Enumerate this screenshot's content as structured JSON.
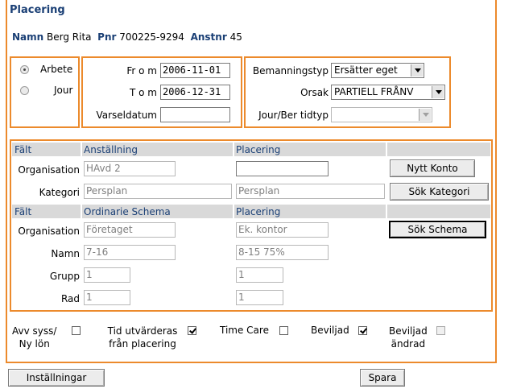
{
  "title": "Placering",
  "person": {
    "namn_label": "Namn",
    "namn_value": "Berg Rita",
    "pnr_label": "Pnr",
    "pnr_value": "700225-9294",
    "anstnr_label": "Anstnr",
    "anstnr_value": "45"
  },
  "type_radio": {
    "arbete": "Arbete",
    "jour": "Jour",
    "selected": "Arbete"
  },
  "dates": {
    "from_label": "Fr o m",
    "from_value": "2006-11-01",
    "tom_label": "T o m",
    "tom_value": "2006-12-31",
    "varsel_label": "Varseldatum",
    "varsel_value": ""
  },
  "staffing": {
    "bemanningstyp_label": "Bemanningstyp",
    "bemanningstyp_value": "Ersätter eget",
    "orsak_label": "Orsak",
    "orsak_value": "PARTIELL FRÅNV",
    "jourber_label": "Jour/Ber tidtyp",
    "jourber_value": ""
  },
  "grid": {
    "col_falt": "Fält",
    "col_anstallning": "Anställning",
    "col_placering": "Placering",
    "col_ordinarie": "Ordinarie Schema",
    "rows": {
      "organisation": "Organisation",
      "kategori": "Kategori",
      "namn": "Namn",
      "grupp": "Grupp",
      "rad": "Rad"
    },
    "anst_org": "HAvd 2",
    "plac_org": "",
    "anst_kat": "Persplan",
    "plac_kat": "Persplan",
    "ord_org": "Företaget",
    "plac_org2": "Ek. kontor",
    "ord_namn": "7-16",
    "plac_namn": "8-15 75%",
    "ord_grupp": "1",
    "plac_grupp": "1",
    "ord_rad": "1",
    "plac_rad": "1",
    "btn_nytt_konto": "Nytt Konto",
    "btn_sok_kategori": "Sök Kategori",
    "btn_sok_schema": "Sök Schema"
  },
  "checks": {
    "avv_line1": "Avv syss/",
    "avv_line2": "Ny lön",
    "avv_checked": false,
    "tid_line1": "Tid utvärderas",
    "tid_line2": "från placering",
    "tid_checked": true,
    "timecare": "Time Care",
    "timecare_checked": false,
    "beviljad": "Beviljad",
    "beviljad_checked": true,
    "bev_andrad_line1": "Beviljad",
    "bev_andrad_line2": "ändrad",
    "bev_andrad_checked": false
  },
  "footer": {
    "installningar": "Inställningar",
    "spara": "Spara"
  },
  "colors": {
    "accent_border": "#ec8a2c",
    "heading_text": "#1a3f75",
    "grid_header_bg": "#d9d9d9"
  }
}
